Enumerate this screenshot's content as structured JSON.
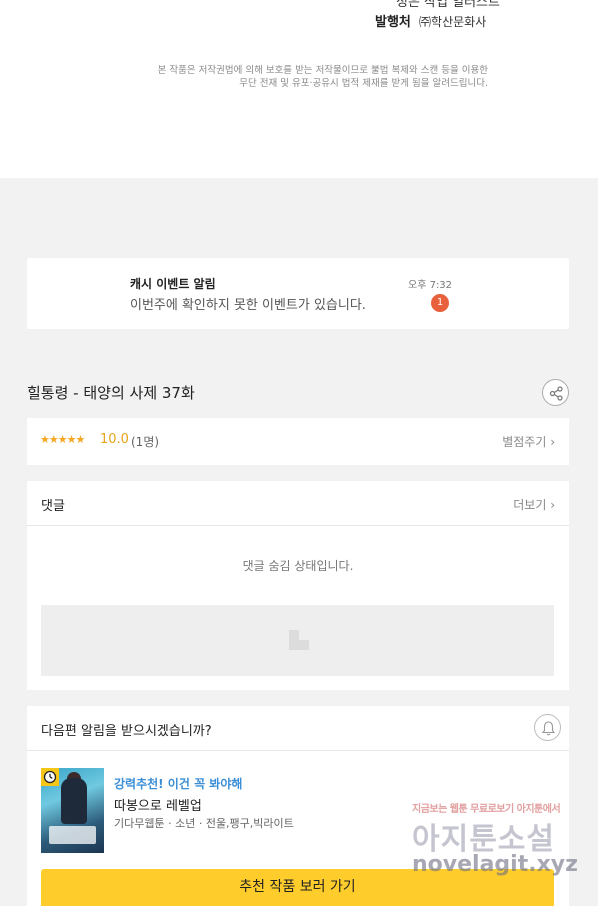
{
  "publication": {
    "partial_text": "정은 작업 일러스트",
    "publisher_label": "발행처",
    "publisher_value": "㈜학산문화사",
    "copyright_line1": "본 작품은 저작권법에 의해 보호를 받는 저작물이므로 불법 복제와 스캔 등을 이용한",
    "copyright_line2": "무단 전재 및 유포·공유시 법적 제재를 받게 됨을 알려드립니다."
  },
  "notification": {
    "title": "캐시 이벤트 알림",
    "body": "이번주에 확인하지 못한 이벤트가 있습니다.",
    "time": "오후 7:32",
    "badge": "1"
  },
  "episode": {
    "title": "힐통령 - 태양의 사제 37화"
  },
  "rating": {
    "stars": "★★★★★",
    "score": "10.0",
    "count": "(1명)",
    "rate_link": "별점주기 ›"
  },
  "comments": {
    "title": "댓글",
    "more": "더보기 ›",
    "hidden_message": "댓글 숨김 상태입니다."
  },
  "next_episode": {
    "question": "다음편 알림을 받으시겠습니까?",
    "promo": "강력추천! 이건 꼭 봐야해",
    "work_title": "따봉으로 레벨업",
    "work_meta": "기다무웹툰 · 소년 · 전울,팽구,빅라이트",
    "button": "추천 작품 보러 가기"
  },
  "watermark": {
    "small": "지금보는 웹툰 무료로보기 아지툰에서",
    "big": "아지툰소설",
    "url": "novelagit.xyz"
  },
  "colors": {
    "accent_yellow": "#ffcd2b",
    "badge_red": "#e8603c",
    "promo_blue": "#3b8fd6",
    "star_orange": "#f5a623"
  }
}
